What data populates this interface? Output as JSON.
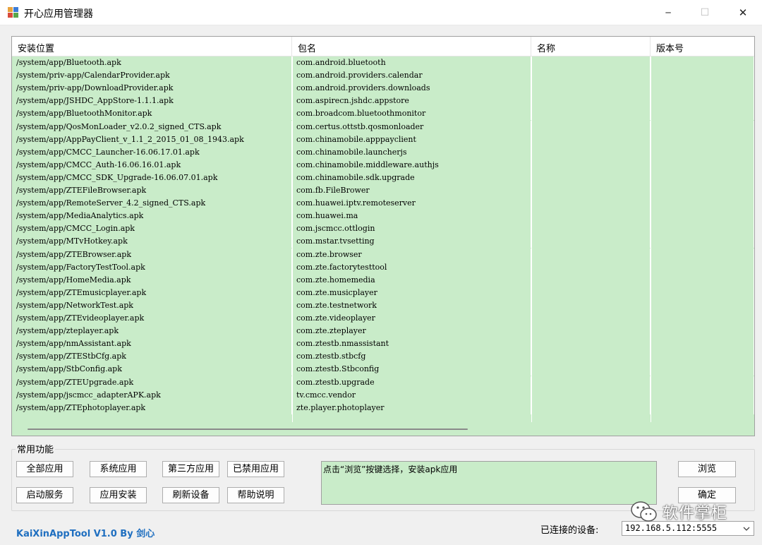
{
  "window": {
    "title": "开心应用管理器",
    "minimize_glyph": "─",
    "maximize_glyph": "☐",
    "close_glyph": "✕"
  },
  "colors": {
    "row_green": "#c9ecc9",
    "brand_blue": "#1f6fc0"
  },
  "table": {
    "columns": [
      "安装位置",
      "包名",
      "名称",
      "版本号"
    ],
    "rows": [
      [
        "/system/app/Bluetooth.apk",
        "com.android.bluetooth",
        "",
        ""
      ],
      [
        "/system/priv-app/CalendarProvider.apk",
        "com.android.providers.calendar",
        "",
        ""
      ],
      [
        "/system/priv-app/DownloadProvider.apk",
        "com.android.providers.downloads",
        "",
        ""
      ],
      [
        "/system/app/JSHDC_AppStore-1.1.1.apk",
        "com.aspirecn.jshdc.appstore",
        "",
        ""
      ],
      [
        "/system/app/BluetoothMonitor.apk",
        "com.broadcom.bluetoothmonitor",
        "",
        ""
      ],
      [
        "/system/app/QosMonLoader_v2.0.2_signed_CTS.apk",
        "com.certus.ottstb.qosmonloader",
        "",
        ""
      ],
      [
        "/system/app/AppPayClient_v_1.1_2_2015_01_08_1943.apk",
        "com.chinamobile.apppayclient",
        "",
        ""
      ],
      [
        "/system/app/CMCC_Launcher-16.06.17.01.apk",
        "com.chinamobile.launcherjs",
        "",
        ""
      ],
      [
        "/system/app/CMCC_Auth-16.06.16.01.apk",
        "com.chinamobile.middleware.authjs",
        "",
        ""
      ],
      [
        "/system/app/CMCC_SDK_Upgrade-16.06.07.01.apk",
        "com.chinamobile.sdk.upgrade",
        "",
        ""
      ],
      [
        "/system/app/ZTEFileBrowser.apk",
        "com.fb.FileBrower",
        "",
        ""
      ],
      [
        "/system/app/RemoteServer_4.2_signed_CTS.apk",
        "com.huawei.iptv.remoteserver",
        "",
        ""
      ],
      [
        "/system/app/MediaAnalytics.apk",
        "com.huawei.ma",
        "",
        ""
      ],
      [
        "/system/app/CMCC_Login.apk",
        "com.jscmcc.ottlogin",
        "",
        ""
      ],
      [
        "/system/app/MTvHotkey.apk",
        "com.mstar.tvsetting",
        "",
        ""
      ],
      [
        "/system/app/ZTEBrowser.apk",
        "com.zte.browser",
        "",
        ""
      ],
      [
        "/system/app/FactoryTestTool.apk",
        "com.zte.factorytesttool",
        "",
        ""
      ],
      [
        "/system/app/HomeMedia.apk",
        "com.zte.homemedia",
        "",
        ""
      ],
      [
        "/system/app/ZTEmusicplayer.apk",
        "com.zte.musicplayer",
        "",
        ""
      ],
      [
        "/system/app/NetworkTest.apk",
        "com.zte.testnetwork",
        "",
        ""
      ],
      [
        "/system/app/ZTEvideoplayer.apk",
        "com.zte.videoplayer",
        "",
        ""
      ],
      [
        "/system/app/zteplayer.apk",
        "com.zte.zteplayer",
        "",
        ""
      ],
      [
        "/system/app/nmAssistant.apk",
        "com.ztestb.nmassistant",
        "",
        ""
      ],
      [
        "/system/app/ZTEStbCfg.apk",
        "com.ztestb.stbcfg",
        "",
        ""
      ],
      [
        "/system/app/StbConfig.apk",
        "com.ztestb.Stbconfig",
        "",
        ""
      ],
      [
        "/system/app/ZTEUpgrade.apk",
        "com.ztestb.upgrade",
        "",
        ""
      ],
      [
        "/system/app/jscmcc_adapterAPK.apk",
        "tv.cmcc.vendor",
        "",
        ""
      ],
      [
        "/system/app/ZTEphotoplayer.apk",
        "zte.player.photoplayer",
        "",
        ""
      ]
    ]
  },
  "functions": {
    "group_label": "常用功能",
    "buttons": {
      "all_apps": "全部应用",
      "system_apps": "系统应用",
      "third_party_apps": "第三方应用",
      "disabled_apps": "已禁用应用",
      "start_service": "启动服务",
      "install_app": "应用安装",
      "refresh_devices": "刷新设备",
      "help": "帮助说明",
      "browse": "浏览",
      "confirm": "确定"
    },
    "info_text": "点击“浏览”按键选择，安装apk应用"
  },
  "footer": {
    "brand": "KaiXinAppTool V1.0 By 剑心",
    "connected_label": "已连接的设备:",
    "device_selected": "192.168.5.112:5555"
  },
  "watermark": {
    "text": "软件掌柜",
    "icon": "wechat-icon"
  }
}
